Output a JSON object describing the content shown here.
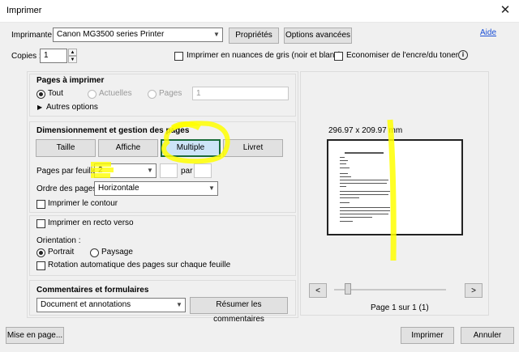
{
  "window": {
    "title": "Imprimer",
    "close_glyph": "✕"
  },
  "header": {
    "printer_label": "Imprimante :",
    "printer_value": "Canon MG3500 series Printer",
    "properties_button": "Propriétés",
    "advanced_button": "Options avancées",
    "help_link": "Aide",
    "copies_label": "Copies :",
    "copies_value": "1",
    "grayscale_label": "Imprimer en nuances de gris (noir et blanc)",
    "save_ink_label": "Economiser de l'encre/du toner",
    "info_glyph": "i"
  },
  "pages_section": {
    "title": "Pages à imprimer",
    "all_label": "Tout",
    "current_label": "Actuelles",
    "pages_label": "Pages",
    "pages_value": "1",
    "more_options_label": "Autres options"
  },
  "sizing_section": {
    "title": "Dimensionnement et gestion des pages",
    "tabs": [
      {
        "label": "Taille",
        "active": false
      },
      {
        "label": "Affiche",
        "active": false
      },
      {
        "label": "Multiple",
        "active": true
      },
      {
        "label": "Livret",
        "active": false
      }
    ],
    "pages_per_sheet_label": "Pages par feuille :",
    "pages_per_sheet_value": "2",
    "par_label": "par",
    "page_order_label": "Ordre des pages :",
    "page_order_value": "Horizontale",
    "print_border_label": "Imprimer le contour"
  },
  "duplex_section": {
    "duplex_label": "Imprimer en recto verso",
    "orientation_label": "Orientation :",
    "portrait_label": "Portrait",
    "landscape_label": "Paysage",
    "auto_rotate_label": "Rotation automatique des pages sur chaque feuille"
  },
  "comments_section": {
    "title": "Commentaires et formulaires",
    "dropdown_value": "Document et annotations",
    "summarize_button": "Résumer les commentaires"
  },
  "preview": {
    "dimensions": "296.97 x 209.97 mm",
    "prev_glyph": "<",
    "next_glyph": ">",
    "page_status": "Page 1 sur 1 (1)"
  },
  "footer": {
    "page_setup_button": "Mise en page...",
    "print_button": "Imprimer",
    "cancel_button": "Annuler"
  },
  "colors": {
    "highlight": "#ffff00",
    "active_border": "#1a6b3a",
    "link": "#1a4fd6"
  }
}
